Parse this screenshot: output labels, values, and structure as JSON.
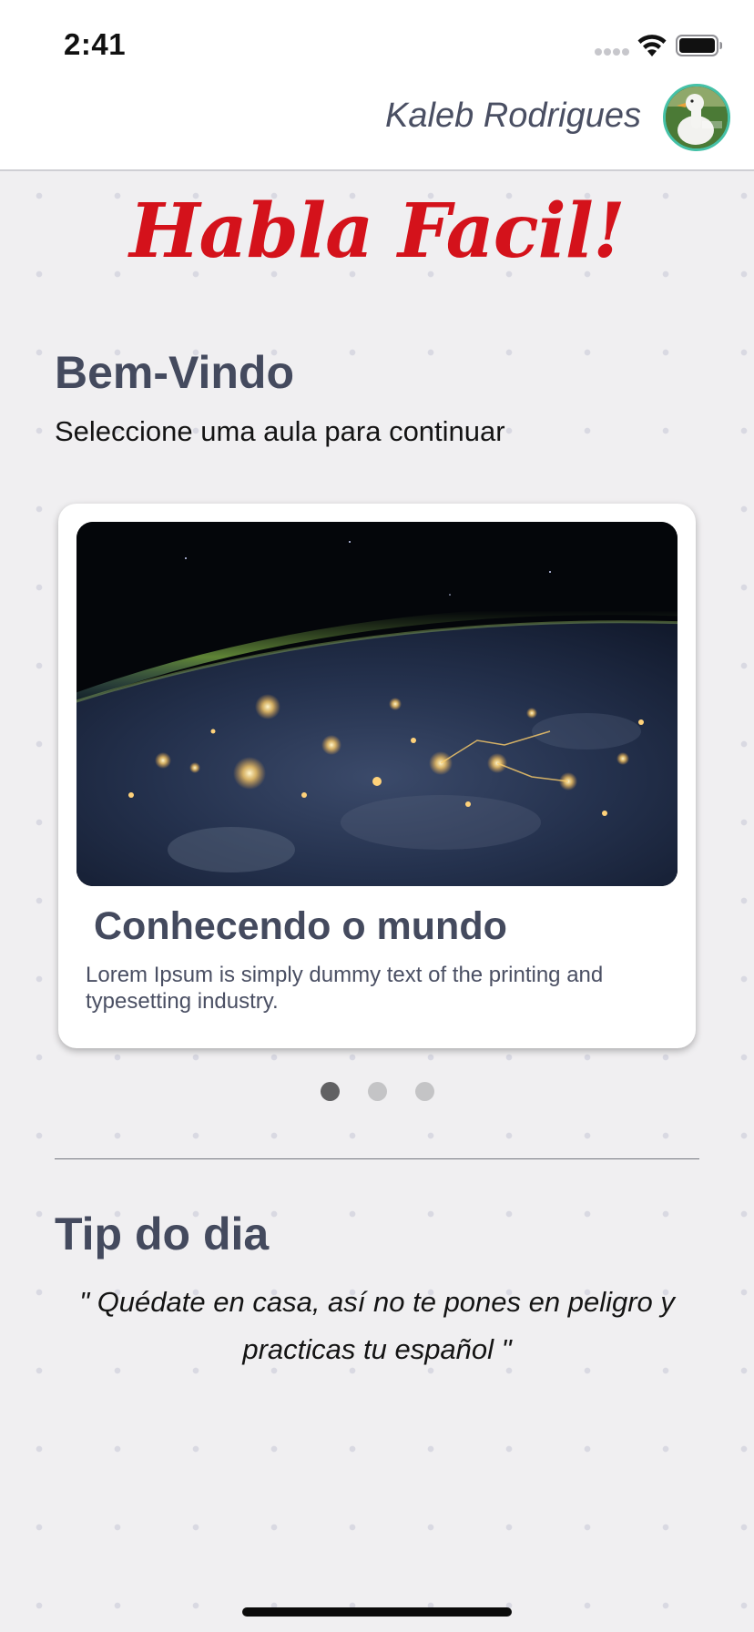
{
  "status_bar": {
    "time": "2:41",
    "icons": [
      "cellular-signal-icon",
      "wifi-icon",
      "battery-icon"
    ]
  },
  "header": {
    "user_name": "Kaleb Rodrigues",
    "avatar": "user-avatar-duck-photo"
  },
  "app": {
    "logo_text": "Habla Facil!",
    "brand_color": "#d4121b"
  },
  "welcome": {
    "title": "Bem-Vindo",
    "subtitle": "Seleccione uma aula para continuar"
  },
  "lesson_carousel": {
    "active_index": 0,
    "page_count": 3,
    "cards": [
      {
        "image": "earth-at-night-from-space",
        "title": "Conhecendo o mundo",
        "description": "Lorem Ipsum is simply dummy text of the printing and typesetting industry."
      }
    ]
  },
  "tip": {
    "title": "Tip do dia",
    "quote": "\" Quédate en casa, así no te pones en peligro y practicas tu español \""
  },
  "colors": {
    "background": "#f0eff1",
    "heading": "#444a5e",
    "avatar_ring": "#45c1a7",
    "dot_active": "#616163",
    "dot_inactive": "#c4c4c6"
  }
}
